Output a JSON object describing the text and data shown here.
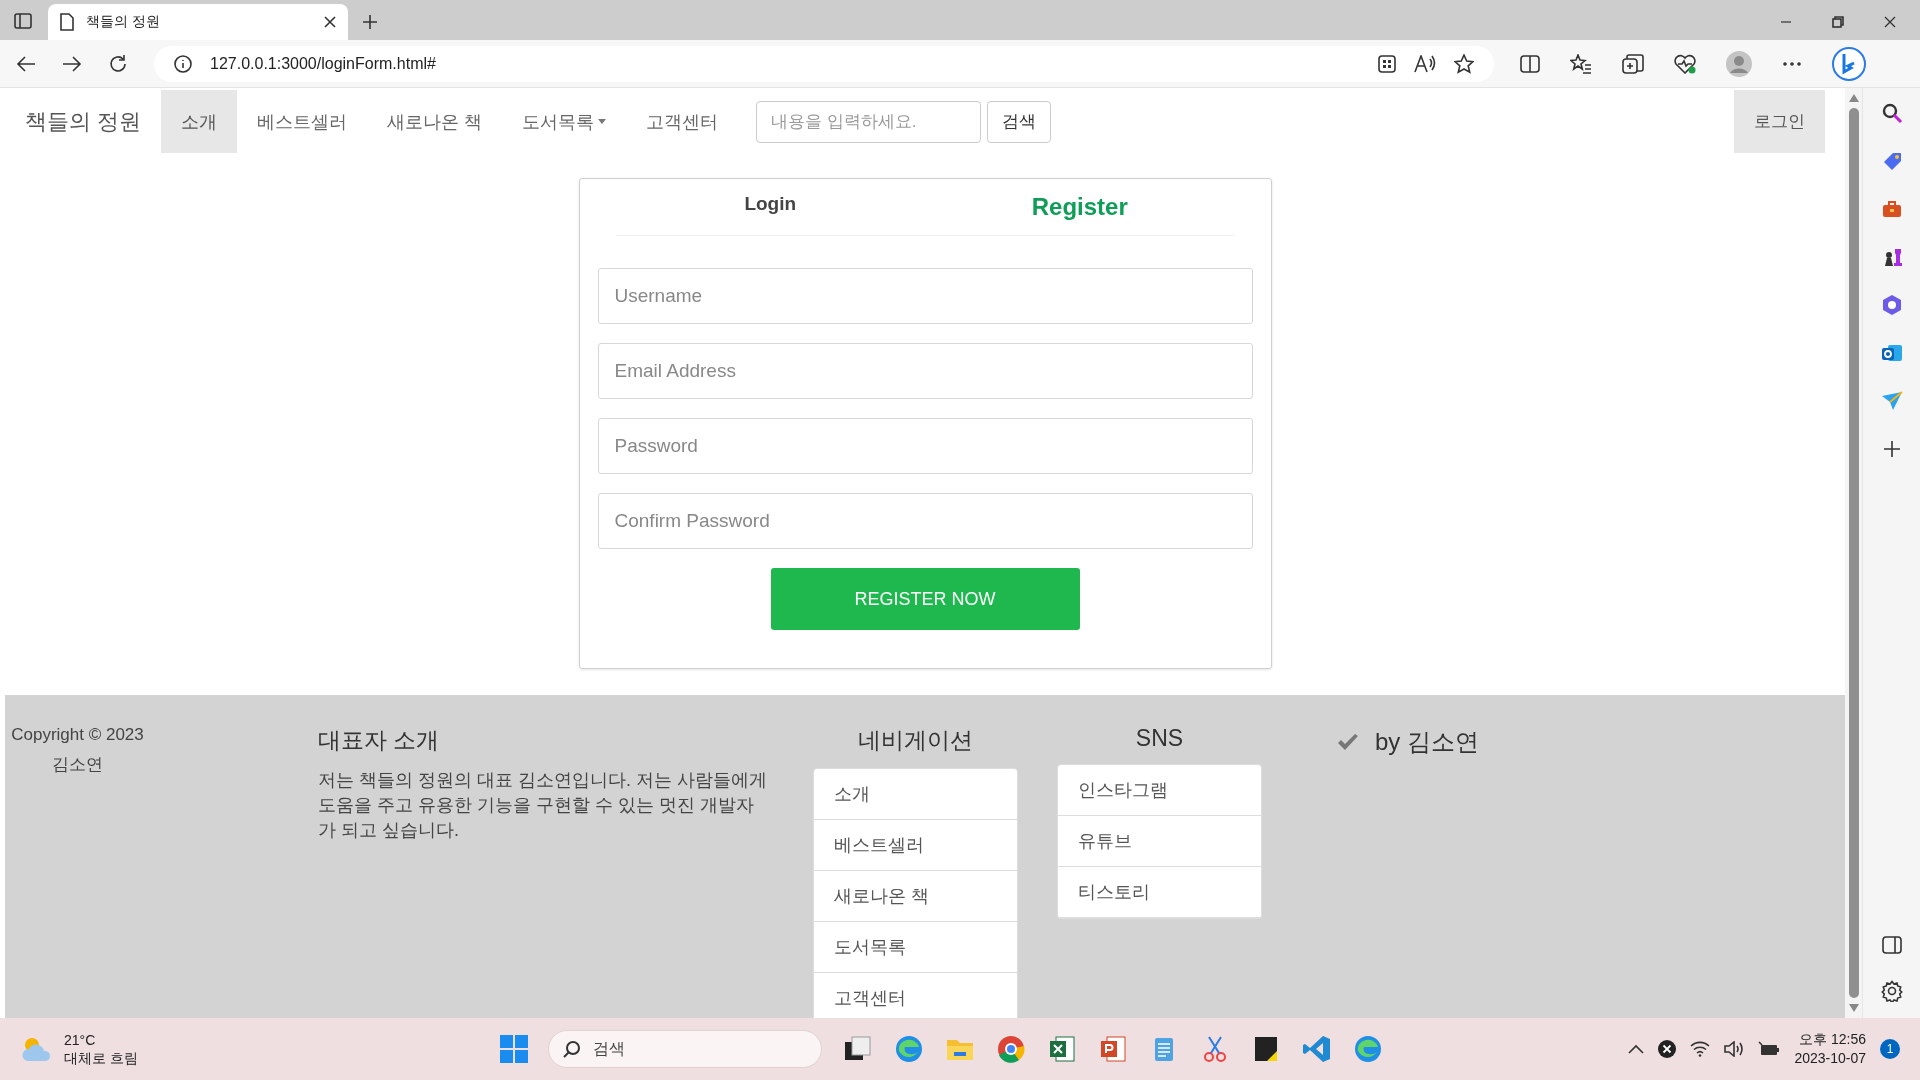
{
  "browser": {
    "tabs": [
      {
        "title": "책들의 정원",
        "selected": true
      }
    ],
    "address": "127.0.0.1:3000/loginForm.html#"
  },
  "navbar": {
    "brand": "책들의 정원",
    "items": [
      {
        "label": "소개",
        "selected": true,
        "kind": "link"
      },
      {
        "label": "베스트셀러",
        "selected": false,
        "kind": "link"
      },
      {
        "label": "새로나온 책",
        "selected": false,
        "kind": "link"
      },
      {
        "label": "도서목록",
        "selected": false,
        "kind": "dropdown"
      },
      {
        "label": "고객센터",
        "selected": false,
        "kind": "link"
      }
    ],
    "search": {
      "placeholder": "내용을 입력하세요.",
      "button": "검색"
    },
    "login_button": "로그인"
  },
  "form": {
    "tabs": [
      {
        "label": "Login",
        "selected": false
      },
      {
        "label": "Register",
        "selected": true
      }
    ],
    "fields": [
      {
        "placeholder": "Username"
      },
      {
        "placeholder": "Email Address"
      },
      {
        "placeholder": "Password"
      },
      {
        "placeholder": "Confirm Password"
      }
    ],
    "submit": "REGISTER NOW"
  },
  "footer": {
    "copyright": [
      "Copyright © 2023",
      "김소연"
    ],
    "about": {
      "title": "대표자 소개",
      "text": "저는 책들의 정원의 대표 김소연입니다. 저는 사람들에게 도움을 주고 유용한 기능을 구현할 수 있는 멋진 개발자가 되고 싶습니다."
    },
    "navigation": {
      "title": "네비게이션",
      "items": [
        "소개",
        "베스트셀러",
        "새로나온 책",
        "도서목록",
        "고객센터"
      ]
    },
    "sns": {
      "title": "SNS",
      "items": [
        "인스타그램",
        "유튜브",
        "티스토리"
      ]
    },
    "credit": "by 김소연"
  },
  "taskbar": {
    "weather": {
      "temp": "21°C",
      "desc": "대체로 흐림"
    },
    "search_placeholder": "검색",
    "clock": {
      "time": "오후 12:56",
      "date": "2023-10-07"
    },
    "notifications": "1"
  }
}
